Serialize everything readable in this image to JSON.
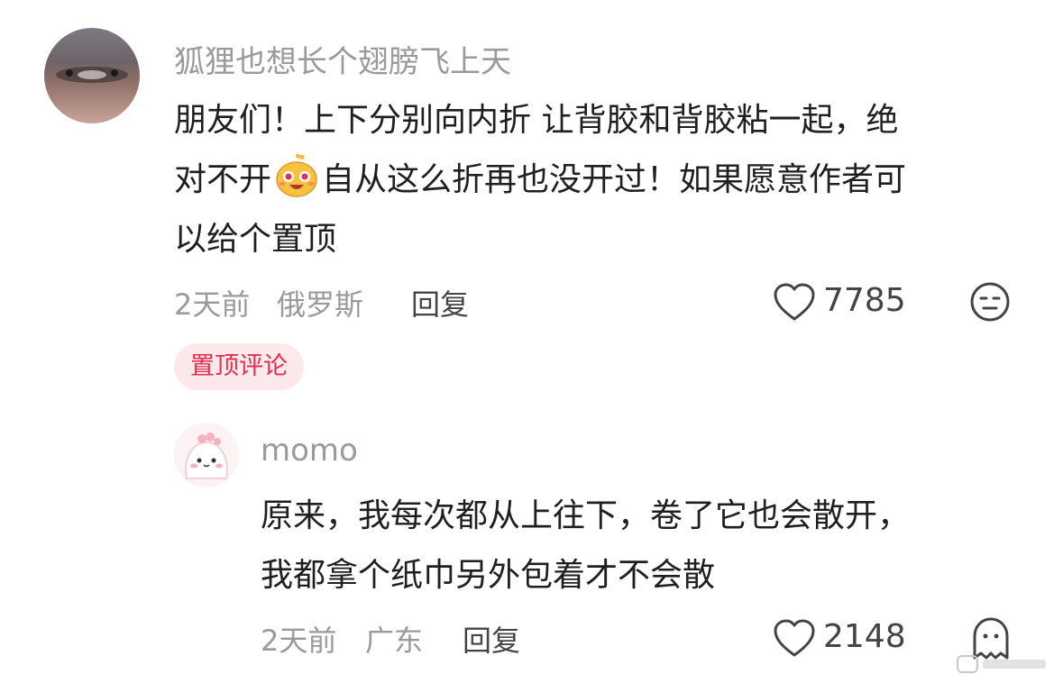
{
  "comments": [
    {
      "username": "狐狸也想长个翅膀飞上天",
      "text_line1": "朋友们！上下分别向内折 让背胶和背胶粘一起，绝",
      "text_line2_before": "对不开",
      "text_line2_after": "自从这么折再也没开过！如果愿意作者可",
      "text_line3": "以给个置顶",
      "time": "2天前",
      "location": "俄罗斯",
      "reply_label": "回复",
      "like_count": "7785",
      "pinned_label": "置顶评论"
    }
  ],
  "replies": [
    {
      "username": "momo",
      "text_line1": "原来，我每次都从上往下，卷了它也会散开，",
      "text_line2": "我都拿个纸巾另外包着才不会散",
      "time": "2天前",
      "location": "广东",
      "reply_label": "回复",
      "like_count": "2148"
    }
  ],
  "colors": {
    "pinned_bg": "#fde8ec",
    "pinned_text": "#e0304d"
  }
}
